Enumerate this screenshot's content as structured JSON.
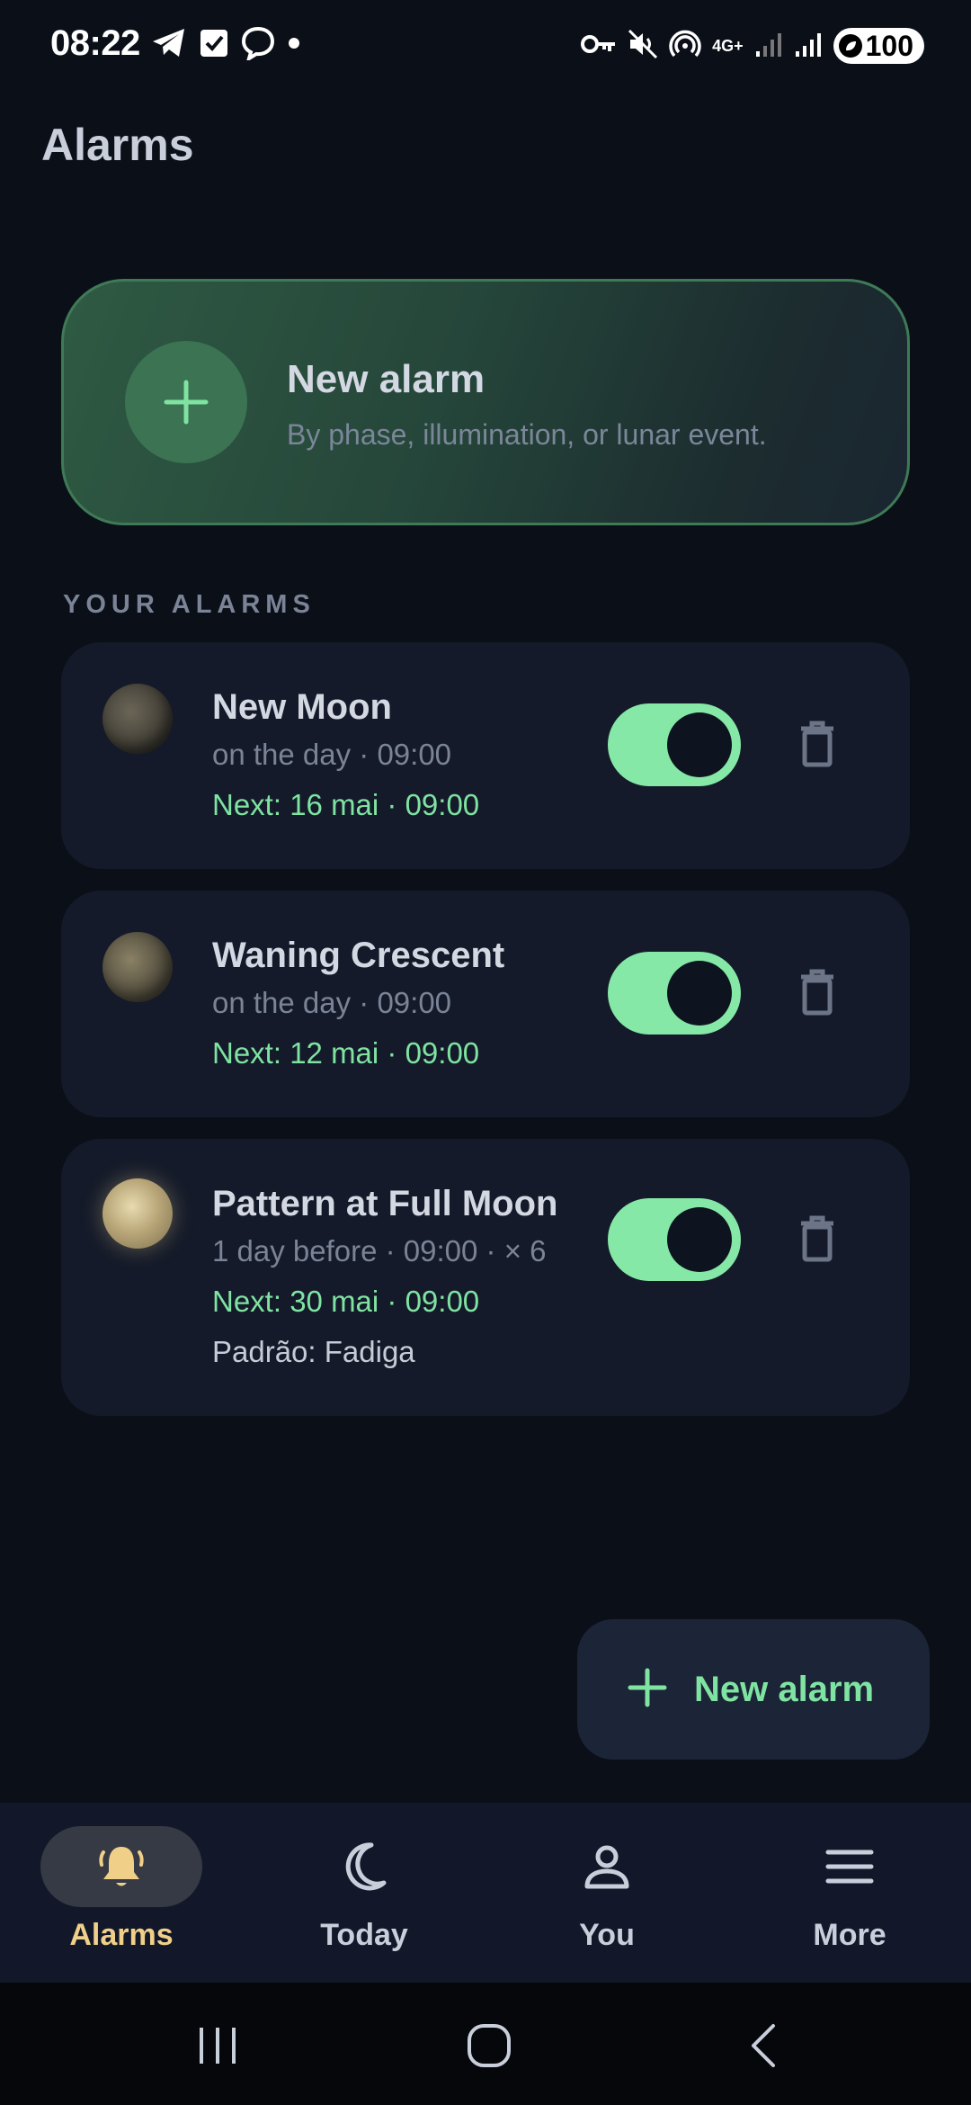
{
  "status_bar": {
    "time": "08:22",
    "network": "4G+",
    "battery": "100",
    "icons": [
      "telegram-icon",
      "checkbox-icon",
      "chat-bubble-icon",
      "dot-icon",
      "vpn-key-icon",
      "mute-icon",
      "hotspot-icon",
      "signal-icon",
      "battery-icon"
    ]
  },
  "page": {
    "title": "Alarms"
  },
  "hero": {
    "title": "New alarm",
    "subtitle": "By phase, illumination, or lunar event.",
    "icon": "plus-icon"
  },
  "section": {
    "label": "YOUR ALARMS"
  },
  "alarms": [
    {
      "name": "New Moon",
      "schedule": "on the day · 09:00",
      "next": "Next: 16 mai · 09:00",
      "enabled": true,
      "icon": "new-moon-icon"
    },
    {
      "name": "Waning Crescent",
      "schedule": "on the day · 09:00",
      "next": "Next: 12 mai · 09:00",
      "enabled": true,
      "icon": "waning-crescent-moon-icon"
    },
    {
      "name": "Pattern at Full Moon",
      "schedule": "1 day before · 09:00 · × 6",
      "next": "Next: 30 mai · 09:00",
      "pattern": "Padrão: Fadiga",
      "enabled": true,
      "icon": "full-moon-icon"
    }
  ],
  "fab": {
    "label": "New alarm",
    "icon": "plus-icon"
  },
  "nav": {
    "items": [
      {
        "label": "Alarms",
        "icon": "bell-icon",
        "active": true
      },
      {
        "label": "Today",
        "icon": "crescent-moon-icon",
        "active": false
      },
      {
        "label": "You",
        "icon": "person-icon",
        "active": false
      },
      {
        "label": "More",
        "icon": "menu-icon",
        "active": false
      }
    ]
  },
  "system_nav": {
    "icons": [
      "recent-apps-icon",
      "home-icon",
      "back-icon"
    ]
  },
  "colors": {
    "background": "#0b0f18",
    "card": "#141a29",
    "accent_green": "#7fe3a2",
    "toggle_on": "#86e8a7",
    "active_nav": "#f0cf89"
  }
}
